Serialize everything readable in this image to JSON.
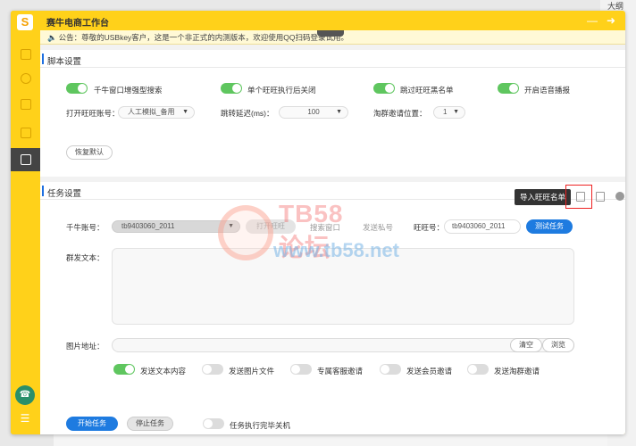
{
  "app": {
    "title": "赛牛电商工作台",
    "logo": "S"
  },
  "background": {
    "right_text": "大纲"
  },
  "notice": {
    "icon": "speaker-icon",
    "text": "公告：尊敬的USBkey客户，这是一个非正式的内测版本，欢迎使用QQ扫码登录试用。",
    "link": ""
  },
  "script_settings": {
    "title": "脚本设置",
    "toggles": [
      {
        "label": "千牛窗口增强型搜索",
        "on": true
      },
      {
        "label": "单个旺旺执行后关闭",
        "on": true
      },
      {
        "label": "跳过旺旺黑名单",
        "on": true
      },
      {
        "label": "开启语音播报",
        "on": true
      }
    ],
    "open_wangwang_label": "打开旺旺账号：",
    "open_wangwang_value": "人工模拟_备用",
    "jump_delay_label": "跳转延迟(ms)：",
    "jump_delay_value": "100",
    "group_invite_label": "淘群邀请位置：",
    "group_invite_value": "1",
    "restore_default": "恢复默认"
  },
  "task_settings": {
    "title": "任务设置",
    "import_tooltip": "导入旺旺名单",
    "qianniu_label": "千牛账号：",
    "qianniu_value": "tb9403060_2011",
    "hidden_btn1": "打开旺旺",
    "hidden_btn2": "搜索窗口",
    "hidden_btn3": "发送私号",
    "wangwang_label": "旺旺号：",
    "wangwang_value": "tb9403060_2011",
    "test_task": "测试任务",
    "group_text_label": "群发文本：",
    "image_addr_label": "图片地址：",
    "clear": "清空",
    "browse": "浏览",
    "send_options": [
      {
        "label": "发送文本内容",
        "on": true
      },
      {
        "label": "发送图片文件",
        "on": false
      },
      {
        "label": "专属客服邀请",
        "on": false
      },
      {
        "label": "发送会员邀请",
        "on": false
      },
      {
        "label": "发送淘群邀请",
        "on": false
      }
    ],
    "start_task": "开始任务",
    "stop_task": "停止任务",
    "shutdown_label": "任务执行完毕关机",
    "shutdown_on": false
  },
  "watermark": {
    "title": "TB58论坛",
    "url": "www.tb58.net"
  },
  "colors": {
    "brand_yellow": "#ffd11a",
    "primary_blue": "#1e7be0",
    "switch_green": "#5fc65f"
  }
}
